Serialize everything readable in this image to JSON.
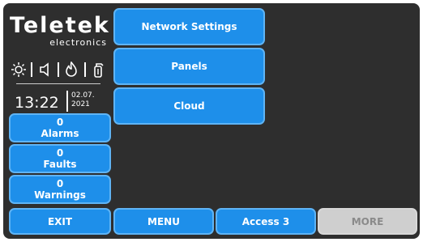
{
  "logo": {
    "brand": "Teletek",
    "sub": "electronics"
  },
  "status": {
    "time": "13:22",
    "date_line1": "02.07.",
    "date_line2": "2021"
  },
  "counters": {
    "alarms": {
      "count": "0",
      "label": "Alarms"
    },
    "faults": {
      "count": "0",
      "label": "Faults"
    },
    "warnings": {
      "count": "0",
      "label": "Warnings"
    }
  },
  "menu": {
    "items": [
      {
        "label": "Network Settings"
      },
      {
        "label": "Panels"
      },
      {
        "label": "Cloud"
      }
    ]
  },
  "footer": {
    "exit": "EXIT",
    "menu": "MENU",
    "access": "Access 3",
    "more": "MORE"
  },
  "icons": [
    "brightness-icon",
    "speaker-icon",
    "fire-icon",
    "extinguisher-icon"
  ],
  "colors": {
    "background": "#2e2e2e",
    "button": "#1e8fea",
    "button_border": "#5fb4f5",
    "disabled": "#cfcfcf"
  }
}
